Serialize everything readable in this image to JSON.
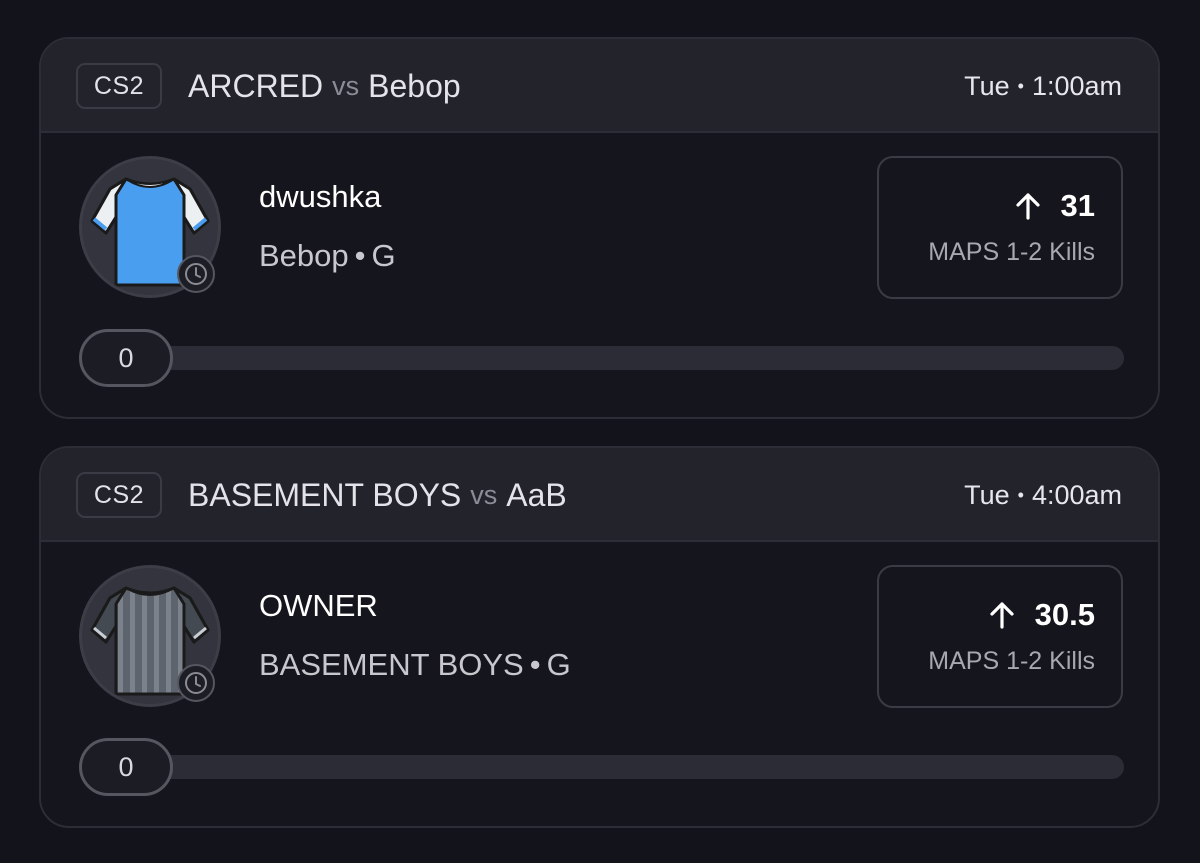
{
  "projections": [
    {
      "game": "CS2",
      "team_a": "ARCRED",
      "vs": "vs",
      "team_b": "Bebop",
      "day": "Tue",
      "time_sep": "•",
      "time": "1:00am",
      "player": "dwushka",
      "player_team": "Bebop",
      "team_sep": "•",
      "position": "G",
      "line": "31",
      "stat": "MAPS 1-2 Kills",
      "progress": "0",
      "direction_icon": "arrow-up-icon",
      "jersey_colors": {
        "body": "#4a9ef0",
        "sleeves": "#ecf0f3"
      }
    },
    {
      "game": "CS2",
      "team_a": "BASEMENT BOYS",
      "vs": "vs",
      "team_b": "AaB",
      "day": "Tue",
      "time_sep": "•",
      "time": "4:00am",
      "player": "OWNER",
      "player_team": "BASEMENT BOYS",
      "team_sep": "•",
      "position": "G",
      "line": "30.5",
      "stat": "MAPS 1-2 Kills",
      "progress": "0",
      "direction_icon": "arrow-up-icon",
      "jersey_colors": {
        "body": "#5d646d",
        "sleeves": "#444a52"
      }
    }
  ]
}
